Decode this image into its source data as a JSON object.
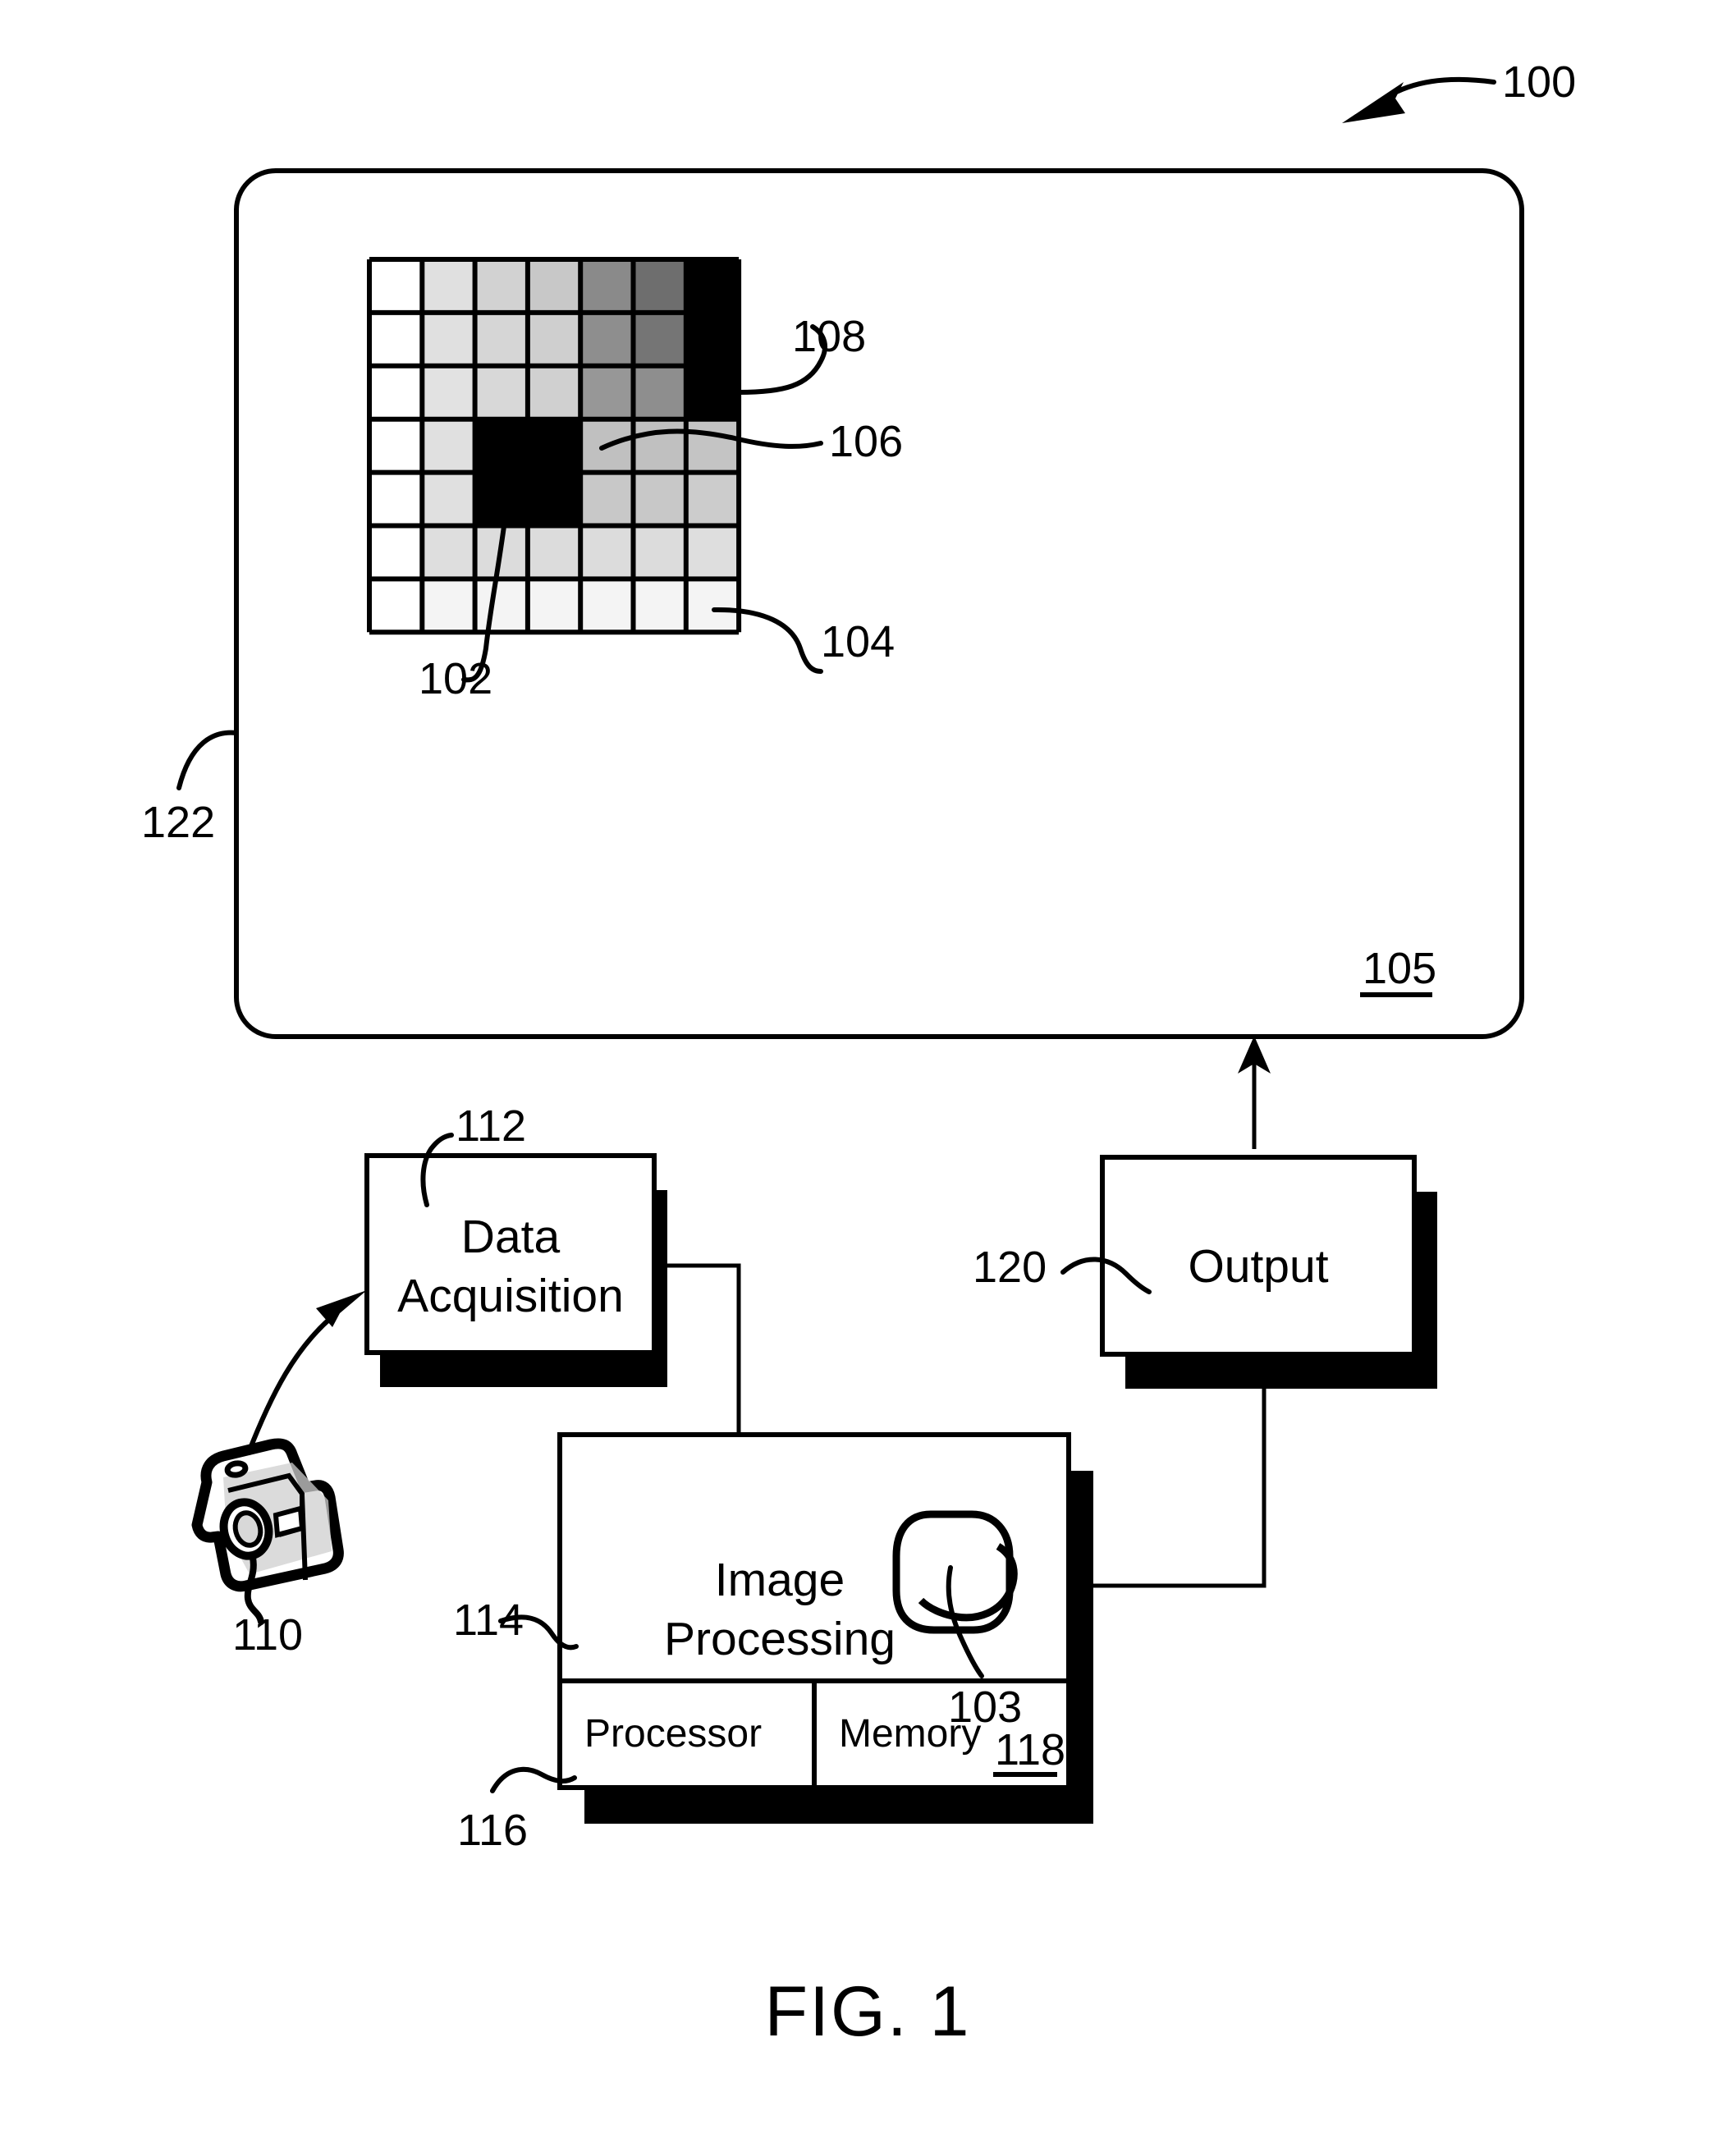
{
  "figure": {
    "caption": "FIG. 1",
    "overall_ref": "100"
  },
  "display": {
    "ref_outer": "122",
    "ref_screen": "105",
    "name": "display-panel"
  },
  "grid": {
    "ref_pixel_black": "102",
    "ref_pixel_plain": "104",
    "ref_pixel_gray": "106",
    "ref_pixel_dark": "108",
    "rows": 7,
    "cols": 7,
    "shades": [
      [
        "#ffffff",
        "#e0e0e0",
        "#d2d2d2",
        "#c8c8c8",
        "#8a8a8a",
        "#6e6e6e",
        "#000000"
      ],
      [
        "#ffffff",
        "#e0e0e0",
        "#d6d6d6",
        "#cfcfcf",
        "#8e8e8e",
        "#757575",
        "#000000"
      ],
      [
        "#ffffff",
        "#e2e2e2",
        "#d8d8d8",
        "#d0d0d0",
        "#979797",
        "#8e8e8e",
        "#000000"
      ],
      [
        "#ffffff",
        "#e0e0e0",
        "#000000",
        "#000000",
        "#c0c0c0",
        "#c0c0c0",
        "#c4c4c4"
      ],
      [
        "#ffffff",
        "#e0e0e0",
        "#000000",
        "#000000",
        "#c8c8c8",
        "#c8c8c8",
        "#cccccc"
      ],
      [
        "#ffffff",
        "#dedede",
        "#dcdcdc",
        "#dcdcdc",
        "#dcdcdc",
        "#dcdcdc",
        "#dedede"
      ],
      [
        "#ffffff",
        "#f4f4f4",
        "#f4f4f4",
        "#f4f4f4",
        "#f4f4f4",
        "#f4f4f4",
        "#f4f4f4"
      ]
    ]
  },
  "camera": {
    "ref": "110",
    "name": "digital-camera"
  },
  "blocks": {
    "data_acquisition": {
      "label_line1": "Data",
      "label_line2": "Acquisition",
      "ref": "112"
    },
    "image_processing": {
      "label_line1": "Image",
      "label_line2": "Processing",
      "ref": "114",
      "blob_ref": "103"
    },
    "processor": {
      "label": "Processor",
      "ref": "116"
    },
    "memory": {
      "label": "Memory",
      "ref": "118"
    },
    "output": {
      "label": "Output",
      "ref": "120"
    }
  },
  "colors": {
    "ink": "#000000",
    "paper": "#ffffff"
  }
}
